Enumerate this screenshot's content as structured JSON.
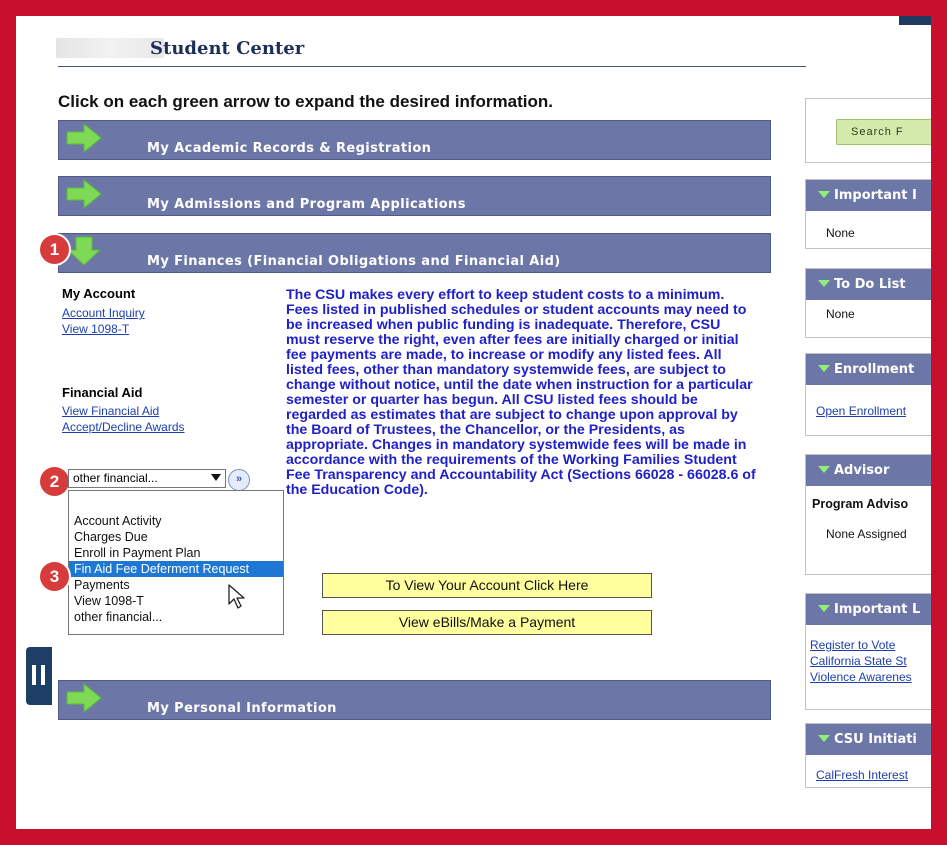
{
  "header": {
    "title": "Student Center"
  },
  "instruction": "Click on each green arrow to expand the desired information.",
  "sections": [
    {
      "label": "My Academic Records & Registration"
    },
    {
      "label": "My Admissions and Program Applications"
    },
    {
      "label": "My Finances (Financial Obligations and Financial Aid)"
    },
    {
      "label": "My Personal Information"
    }
  ],
  "badges": [
    "1",
    "2",
    "3"
  ],
  "finances": {
    "my_account": {
      "heading": "My Account",
      "links": [
        "Account Inquiry",
        "View 1098-T"
      ]
    },
    "financial_aid": {
      "heading": "Financial Aid",
      "links": [
        "View Financial Aid",
        "Accept/Decline Awards"
      ]
    },
    "select": {
      "value": "other financial...",
      "go_label": "»"
    },
    "dropdown_options": [
      "Account Activity",
      "Charges Due",
      "Enroll in Payment Plan",
      "Fin Aid Fee Deferment Request",
      "Payments",
      "View 1098-T",
      "other financial..."
    ],
    "selected_option": "Fin Aid Fee Deferment Request",
    "policy_text": "The CSU makes every effort to keep student costs to a minimum. Fees listed in published schedules or student accounts may need to be increased when public funding is inadequate. Therefore, CSU must reserve the right, even after fees are initially charged or initial fee payments are made, to increase or modify any listed fees. All listed fees, other than mandatory systemwide fees, are subject to change without notice, until the date when instruction for a particular semester or quarter has begun. All CSU listed fees should be regarded as estimates that are subject to change upon approval by the Board of Trustees, the Chancellor, or the Presidents, as appropriate. Changes in mandatory systemwide fees will be made in accordance with the requirements of the Working Families Student Fee Transparency and Accountability Act (Sections 66028 - 66028.6 of the Education Code).",
    "buttons": {
      "view_account": "To View Your Account Click Here",
      "ebills": "View eBills/Make a Payment"
    }
  },
  "sidebar": {
    "search_label": "Search F",
    "important_info": {
      "title": "Important I",
      "text": "None"
    },
    "todo": {
      "title": "To Do List",
      "text": "None"
    },
    "enrollment": {
      "title": "Enrollment",
      "link": "Open Enrollment"
    },
    "advisor": {
      "title": "Advisor",
      "heading": "Program Adviso",
      "text": "None Assigned"
    },
    "important_links": {
      "title": "Important L",
      "links": [
        "Register to Vote",
        "California State St",
        "Violence Awarenes"
      ]
    },
    "csu_initiatives": {
      "title": "CSU Initiati",
      "link": "CalFresh Interest"
    }
  },
  "colors": {
    "frame": "#c8102e",
    "section_bar": "#6c77a8",
    "arrow": "#7ed957",
    "link": "#1d3fb0",
    "policy_text": "#2020c8",
    "highlight": "#1e77d2",
    "button_yellow": "#ffff9e"
  },
  "icons": [
    "green-arrow-icon",
    "chevron-down-icon",
    "double-chevron-right-icon",
    "mouse-pointer-icon",
    "pause-icon",
    "collapse-triangle-icon"
  ]
}
